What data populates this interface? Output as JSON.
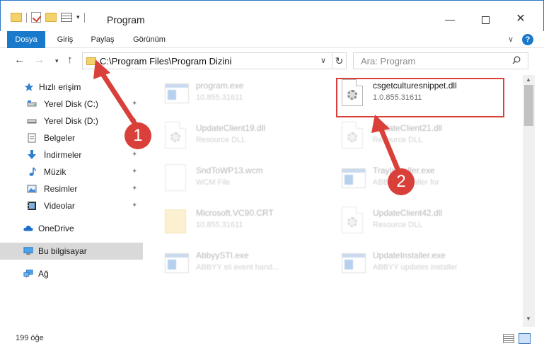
{
  "window": {
    "title": "Program",
    "minimize_glyph": "—",
    "close_glyph": "✕"
  },
  "ribbon": {
    "tabs": [
      "Dosya",
      "Giriş",
      "Paylaş",
      "Görünüm"
    ],
    "expand_glyph": "∨",
    "help_glyph": "?"
  },
  "navigation": {
    "back_glyph": "←",
    "forward_glyph": "→",
    "recent_glyph": "▾",
    "up_glyph": "↑",
    "address": "C:\\Program Files\\Program Dizini",
    "address_dropdown_glyph": "∨",
    "refresh_glyph": "↻",
    "search_placeholder": "Ara: Program"
  },
  "sidebar": {
    "items": [
      {
        "label": "Hızlı erişim",
        "icon": "star-icon"
      },
      {
        "label": "Yerel Disk (C:)",
        "icon": "drive-icon",
        "pinned": true
      },
      {
        "label": "Yerel Disk (D:)",
        "icon": "drive-icon",
        "pinned": true
      },
      {
        "label": "Belgeler",
        "icon": "documents-icon",
        "pinned": true
      },
      {
        "label": "İndirmeler",
        "icon": "download-icon",
        "pinned": true
      },
      {
        "label": "Müzik",
        "icon": "music-icon",
        "pinned": true
      },
      {
        "label": "Resimler",
        "icon": "pictures-icon",
        "pinned": true
      },
      {
        "label": "Videolar",
        "icon": "videos-icon",
        "pinned": true
      },
      {
        "label": "OneDrive",
        "icon": "cloud-icon"
      },
      {
        "label": "Bu bilgisayar",
        "icon": "computer-icon",
        "selected": true
      },
      {
        "label": "Ağ",
        "icon": "network-icon"
      }
    ],
    "pin_glyph": "📌"
  },
  "files": [
    {
      "name": "program.exe",
      "desc": "10.855.31611",
      "icon": "app-icon",
      "faded": true
    },
    {
      "name": "csgetculturesnippet.dll",
      "desc": "1.0.855.31611",
      "icon": "dll-icon",
      "faded": false,
      "highlighted": true
    },
    {
      "name": "UpdateClient19.dll",
      "desc": "Resource DLL",
      "icon": "dll-icon",
      "faded": true
    },
    {
      "name": "UpdateClient21.dll",
      "desc": "Resource DLL",
      "icon": "dll-icon",
      "faded": true
    },
    {
      "name": "SndToWP13.wcm",
      "desc": "WCM File",
      "icon": "file-icon",
      "faded": true
    },
    {
      "name": "TrayInstaller.exe",
      "desc": "ABBYY Installer for",
      "icon": "app-icon",
      "faded": true
    },
    {
      "name": "Microsoft.VC90.CRT",
      "desc": "10.855.31611",
      "icon": "folder-icon",
      "faded": true
    },
    {
      "name": "UpdateClient42.dll",
      "desc": "Resource DLL",
      "icon": "dll-icon",
      "faded": true
    },
    {
      "name": "AbbyySTI.exe",
      "desc": "ABBYY sti event hand...",
      "icon": "app-icon",
      "faded": true
    },
    {
      "name": "UpdateInstaller.exe",
      "desc": "ABBYY updates installer",
      "icon": "app-icon",
      "faded": true
    }
  ],
  "annotations": {
    "step1": "1",
    "step2": "2",
    "color": "#d9403a"
  },
  "status": {
    "item_count": "199 öğe"
  }
}
